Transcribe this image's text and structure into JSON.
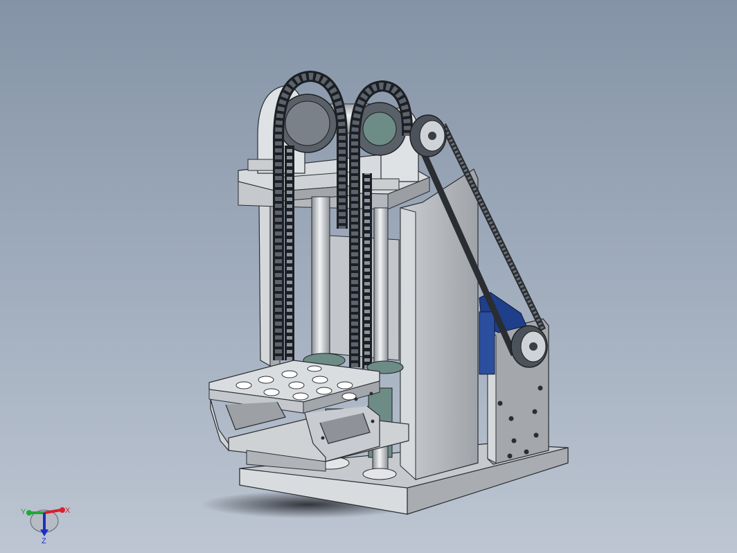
{
  "triad": {
    "x_label": "X",
    "y_label": "Y",
    "z_label": "Z",
    "x_color": "#d8202a",
    "y_color": "#1fa83a",
    "z_color": "#1b2fc4"
  },
  "colors": {
    "background_top": "#8493a6",
    "background_bottom": "#bdc6d2",
    "part_light": "#d9dcdf",
    "part_shade": "#a9adb2",
    "chain": "#3a3f46",
    "motor": "#1f3f8a",
    "bearing": "#6e8c86"
  }
}
